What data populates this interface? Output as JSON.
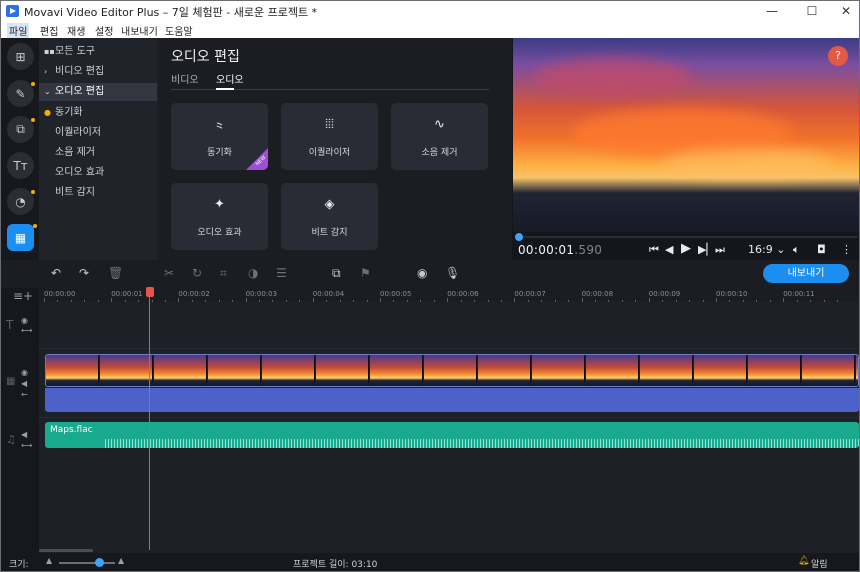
{
  "window": {
    "title": "Movavi Video Editor Plus – 7일 체험판 - 새로운 프로젝트 *",
    "controls": {
      "minimize": "—",
      "maximize": "☐",
      "close": "✕"
    }
  },
  "menu": [
    "파일",
    "편집",
    "재생",
    "설정",
    "내보내기",
    "도움말"
  ],
  "tools_panel": {
    "items": [
      {
        "label": "모든 도구",
        "icon": "grid-icon"
      },
      {
        "label": "비디오 편집",
        "caret": "›"
      },
      {
        "label": "오디오 편집",
        "caret": "⌄"
      },
      {
        "label": "동기화"
      },
      {
        "label": "이퀄라이저"
      },
      {
        "label": "소음 제거"
      },
      {
        "label": "오디오 효과"
      },
      {
        "label": "비트 감지"
      }
    ]
  },
  "effect_panel": {
    "title": "오디오 편집",
    "tabs": [
      "비디오",
      "오디오"
    ],
    "active_tab": "오디오",
    "cards": [
      {
        "label": "동기화",
        "icon": "sync-icon",
        "glyph": "⺀",
        "badge": "NEW"
      },
      {
        "label": "이퀄라이저",
        "icon": "equalizer-icon",
        "glyph": "⦙⦙⦙"
      },
      {
        "label": "소음 제거",
        "icon": "noise-reduction-icon",
        "glyph": "∿"
      },
      {
        "label": "오디오 효과",
        "icon": "audio-effects-icon",
        "glyph": "✦"
      },
      {
        "label": "비트 감지",
        "icon": "beat-detection-icon",
        "glyph": "◈"
      }
    ]
  },
  "preview": {
    "help": "?",
    "time_main": "00:00:01",
    "time_ms": ".590",
    "aspect": "16:9",
    "aspect_caret": "⌄",
    "progress": 0.0,
    "controls": [
      "⏮",
      "◀",
      "▶",
      "▶▏",
      "⏭"
    ]
  },
  "toolbar": {
    "export_label": "내보내기"
  },
  "ruler": {
    "ticks": [
      "00:00:00",
      "00:00:01",
      "00:00:02",
      "00:00:03",
      "00:00:04",
      "00:00:05",
      "00:00:06",
      "00:00:07",
      "00:00:08",
      "00:00:09",
      "00:00:10",
      "00:00:11"
    ]
  },
  "tracks": {
    "audio_clip_name": "Maps.flac"
  },
  "status": {
    "size_label": "크기:",
    "project_length_label": "프로젝트 길이:",
    "project_length": "03:10",
    "notifications_label": "알림"
  },
  "colors": {
    "accent": "#1a8ff0",
    "playhead": "#e8554a",
    "audio_clip": "#19a98c",
    "video_audio": "#4d62c9",
    "new_badge": "#9d4fd6",
    "help": "#e35a44"
  }
}
